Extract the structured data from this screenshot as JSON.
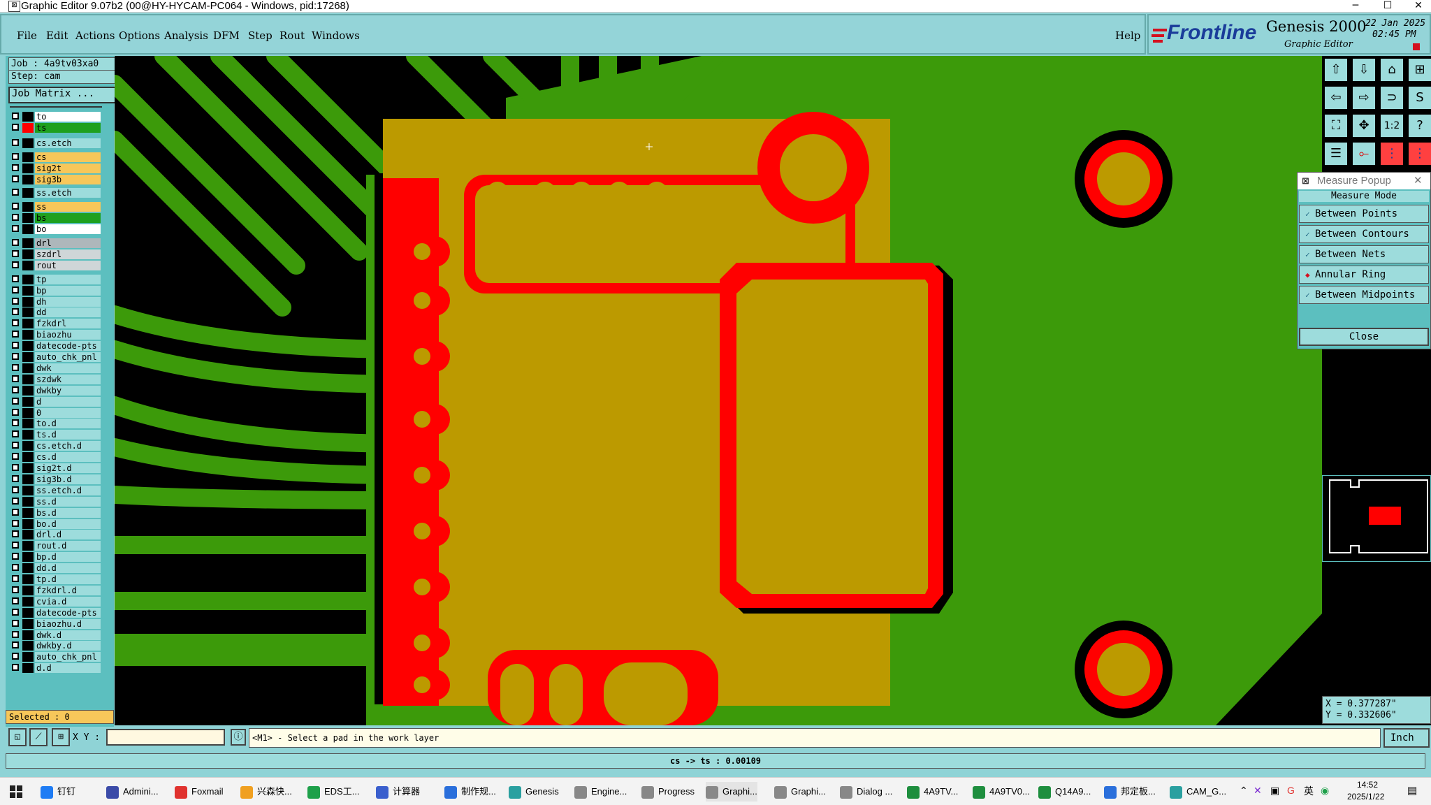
{
  "window": {
    "title": "Graphic Editor 9.07b2 (00@HY-HYCAM-PC064 - Windows, pid:17268)",
    "minimize": "─",
    "maximize": "☐",
    "close": "✕"
  },
  "menu": {
    "items": [
      "File",
      "Edit",
      "Actions",
      "Options",
      "Analysis",
      "DFM",
      "Step",
      "Rout",
      "Windows"
    ],
    "help": "Help"
  },
  "brand": {
    "logo": "Frontline",
    "product": "Genesis 2000",
    "subtitle": "Graphic Editor",
    "date": "22 Jan 2025",
    "time": "02:45 PM"
  },
  "job": {
    "job_label": "Job : 4a9tv03xa0",
    "step_label": "Step: cam",
    "matrix_button": "Job Matrix ..."
  },
  "layers": [
    {
      "name": "to",
      "color": "#ffffff",
      "ind": "#000000"
    },
    {
      "name": "ts",
      "color": "#1ea01e",
      "ind": "#ff0000"
    },
    {
      "name": "cs.etch",
      "color": "#9ddcdc",
      "ind": "#000000"
    },
    {
      "name": "cs",
      "color": "#f7c75a",
      "ind": "#000000"
    },
    {
      "name": "sig2t",
      "color": "#f7c75a",
      "ind": "#000000"
    },
    {
      "name": "sig3b",
      "color": "#f7c75a",
      "ind": "#000000"
    },
    {
      "name": "ss.etch",
      "color": "#9ddcdc",
      "ind": "#000000"
    },
    {
      "name": "ss",
      "color": "#f7c75a",
      "ind": "#000000"
    },
    {
      "name": "bs",
      "color": "#1ea01e",
      "ind": "#000000"
    },
    {
      "name": "bo",
      "color": "#ffffff",
      "ind": "#000000"
    },
    {
      "name": "drl",
      "color": "#aeb7bb",
      "ind": "#000000"
    },
    {
      "name": "szdrl",
      "color": "#cfd6d8",
      "ind": "#000000"
    },
    {
      "name": "rout",
      "color": "#cfd6d8",
      "ind": "#000000"
    },
    {
      "name": "tp",
      "color": "#9ddcdc",
      "ind": "#000000"
    },
    {
      "name": "bp",
      "color": "#9ddcdc",
      "ind": "#000000"
    },
    {
      "name": "dh",
      "color": "#9ddcdc",
      "ind": "#000000"
    },
    {
      "name": "dd",
      "color": "#9ddcdc",
      "ind": "#000000"
    },
    {
      "name": "fzkdrl",
      "color": "#9ddcdc",
      "ind": "#000000"
    },
    {
      "name": "biaozhu",
      "color": "#9ddcdc",
      "ind": "#000000"
    },
    {
      "name": "datecode-pts",
      "color": "#9ddcdc",
      "ind": "#000000"
    },
    {
      "name": "auto_chk_pnl",
      "color": "#9ddcdc",
      "ind": "#000000"
    },
    {
      "name": "dwk",
      "color": "#9ddcdc",
      "ind": "#000000"
    },
    {
      "name": "szdwk",
      "color": "#9ddcdc",
      "ind": "#000000"
    },
    {
      "name": "dwkby",
      "color": "#9ddcdc",
      "ind": "#000000"
    },
    {
      "name": "d",
      "color": "#9ddcdc",
      "ind": "#000000"
    },
    {
      "name": "0",
      "color": "#9ddcdc",
      "ind": "#000000"
    },
    {
      "name": "to.d",
      "color": "#9ddcdc",
      "ind": "#000000"
    },
    {
      "name": "ts.d",
      "color": "#9ddcdc",
      "ind": "#000000"
    },
    {
      "name": "cs.etch.d",
      "color": "#9ddcdc",
      "ind": "#000000"
    },
    {
      "name": "cs.d",
      "color": "#9ddcdc",
      "ind": "#000000"
    },
    {
      "name": "sig2t.d",
      "color": "#9ddcdc",
      "ind": "#000000"
    },
    {
      "name": "sig3b.d",
      "color": "#9ddcdc",
      "ind": "#000000"
    },
    {
      "name": "ss.etch.d",
      "color": "#9ddcdc",
      "ind": "#000000"
    },
    {
      "name": "ss.d",
      "color": "#9ddcdc",
      "ind": "#000000"
    },
    {
      "name": "bs.d",
      "color": "#9ddcdc",
      "ind": "#000000"
    },
    {
      "name": "bo.d",
      "color": "#9ddcdc",
      "ind": "#000000"
    },
    {
      "name": "drl.d",
      "color": "#9ddcdc",
      "ind": "#000000"
    },
    {
      "name": "rout.d",
      "color": "#9ddcdc",
      "ind": "#000000"
    },
    {
      "name": "bp.d",
      "color": "#9ddcdc",
      "ind": "#000000"
    },
    {
      "name": "dd.d",
      "color": "#9ddcdc",
      "ind": "#000000"
    },
    {
      "name": "tp.d",
      "color": "#9ddcdc",
      "ind": "#000000"
    },
    {
      "name": "fzkdrl.d",
      "color": "#9ddcdc",
      "ind": "#000000"
    },
    {
      "name": "cvia.d",
      "color": "#9ddcdc",
      "ind": "#000000"
    },
    {
      "name": "datecode-pts",
      "color": "#9ddcdc",
      "ind": "#000000"
    },
    {
      "name": "biaozhu.d",
      "color": "#9ddcdc",
      "ind": "#000000"
    },
    {
      "name": "dwk.d",
      "color": "#9ddcdc",
      "ind": "#000000"
    },
    {
      "name": "dwkby.d",
      "color": "#9ddcdc",
      "ind": "#000000"
    },
    {
      "name": "auto_chk_pnl",
      "color": "#9ddcdc",
      "ind": "#000000"
    },
    {
      "name": "d.d",
      "color": "#9ddcdc",
      "ind": "#000000"
    }
  ],
  "selected_label": "Selected : 0",
  "measure_popup": {
    "title": "Measure Popup",
    "close_x": "✕",
    "mode_header": "Measure Mode",
    "options": [
      {
        "label": "Between Points",
        "selected": false
      },
      {
        "label": "Between Contours",
        "selected": false
      },
      {
        "label": "Between Nets",
        "selected": false
      },
      {
        "label": "Annular Ring",
        "selected": true
      },
      {
        "label": "Between Midpoints",
        "selected": false
      }
    ],
    "close_button": "Close"
  },
  "coords": {
    "x": "X = 0.377287\"",
    "y": "Y = 0.332606\""
  },
  "command": {
    "xy_label": "X Y :",
    "xy_value": "",
    "prompt": "<M1> - Select a pad in the work layer",
    "units": "Inch"
  },
  "status": "cs -> ts : 0.00109",
  "taskbar": {
    "apps": [
      {
        "label": "钉钉",
        "color": "#1f7cf4"
      },
      {
        "label": "Admini...",
        "color": "#3b4ba8"
      },
      {
        "label": "Foxmail",
        "color": "#e0322e"
      },
      {
        "label": "兴森快...",
        "color": "#f0a020"
      },
      {
        "label": "EDS工...",
        "color": "#1ea04a"
      },
      {
        "label": "计算器",
        "color": "#3a5fcd"
      },
      {
        "label": "制作规...",
        "color": "#2a6fdb"
      },
      {
        "label": "Genesis",
        "color": "#2aa0a0"
      },
      {
        "label": "Engine...",
        "color": "#888888"
      },
      {
        "label": "Progress",
        "color": "#888888"
      },
      {
        "label": "Graphi...",
        "color": "#888888"
      },
      {
        "label": "Graphi...",
        "color": "#888888"
      },
      {
        "label": "Dialog ...",
        "color": "#888888"
      },
      {
        "label": "4A9TV...",
        "color": "#1e8e3e"
      },
      {
        "label": "4A9TV0...",
        "color": "#1e8e3e"
      },
      {
        "label": "Q14A9...",
        "color": "#1e8e3e"
      },
      {
        "label": "邦定板...",
        "color": "#2a6fdb"
      },
      {
        "label": "CAM_G...",
        "color": "#2aa0a0"
      }
    ],
    "tray_lang": "英",
    "time": "14:52",
    "date": "2025/1/22"
  },
  "colors": {
    "board_green": "#3c9a0a",
    "copper_red": "#ff0000",
    "mask_yellow": "#bc9a00",
    "panel_cyan": "#94d4d8",
    "brand_red": "#d4101f",
    "brand_blue": "#1a3c9a"
  },
  "icons": {
    "window_icon": "graphic-editor-icon",
    "start": "windows-start-icon",
    "radio_on": "diamond-radio-on-icon",
    "radio_off": "check-radio-off-icon"
  }
}
